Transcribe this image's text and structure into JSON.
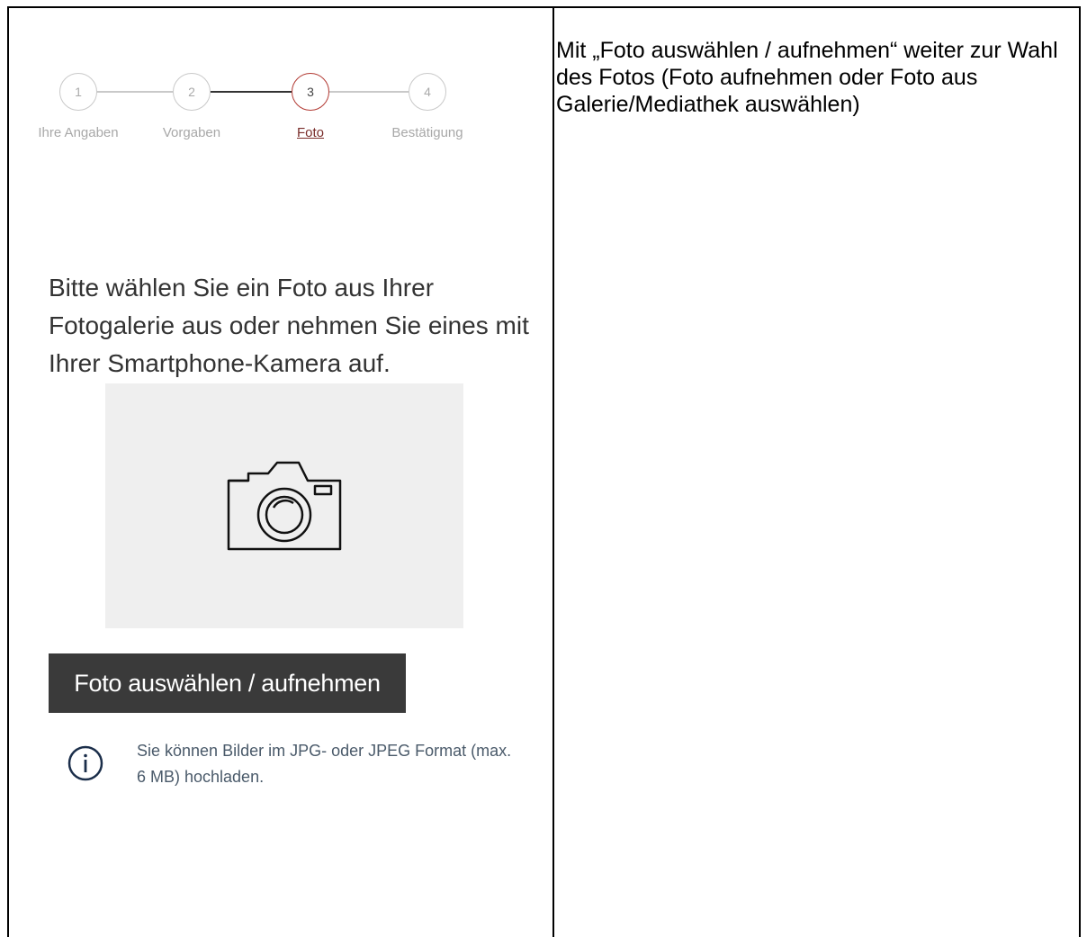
{
  "stepper": {
    "steps": [
      {
        "number": "1",
        "label": "Ihre Angaben"
      },
      {
        "number": "2",
        "label": "Vorgaben"
      },
      {
        "number": "3",
        "label": "Foto"
      },
      {
        "number": "4",
        "label": "Bestätigung"
      }
    ],
    "active_step": 3,
    "active_color": "#b23a33"
  },
  "main": {
    "intro_text": "Bitte wählen Sie ein Foto aus Ihrer Fotogalerie aus oder nehmen Sie eines mit Ihrer Smartphone-Kamera auf.",
    "photo_placeholder_icon": "camera-icon",
    "upload_button_label": "Foto auswählen / aufnehmen",
    "info_icon": "info-icon",
    "info_text": "Sie können Bilder im JPG- oder JPEG Format (max. 6 MB) hochladen."
  },
  "note": {
    "text": "Mit „Foto auswählen / aufnehmen“ weiter zur Wahl des Fotos (Foto aufnehmen oder Foto aus Galerie/Mediathek auswählen)"
  },
  "colors": {
    "button_bg": "#3a3a3a",
    "photo_box_bg": "#efefef"
  }
}
